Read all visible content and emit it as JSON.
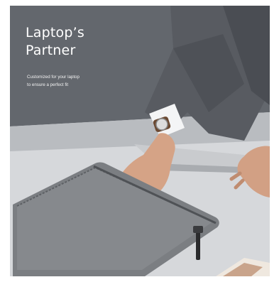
{
  "banner": {
    "headline_line1": "Laptop’s",
    "headline_line2": "Partner",
    "tagline_line1": "Customized for your laptop",
    "tagline_line2": "to ensure a perfect fit"
  },
  "photo_subject": "person-sliding-laptop-into-grey-felt-sleeve",
  "colors": {
    "sleeve": "#7a7c80",
    "sleeve_shadow": "#5b5d61",
    "suit": "#595c62",
    "background_top": "#5f6369",
    "background_bottom": "#e4e5e6",
    "skin": "#d7a88b",
    "text": "#ffffff"
  }
}
